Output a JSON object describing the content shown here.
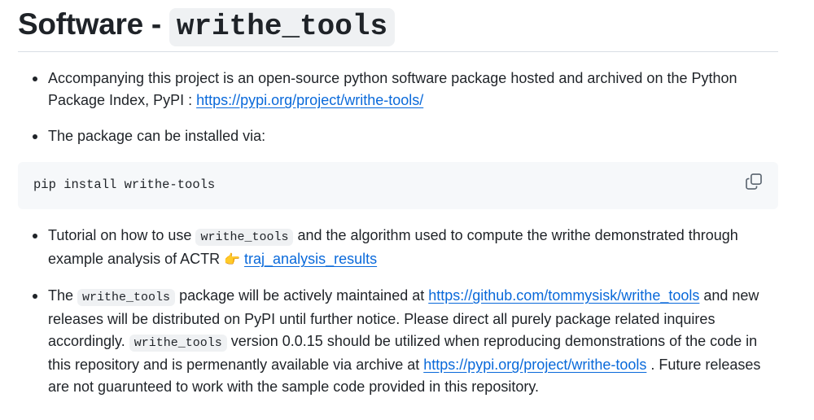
{
  "heading": {
    "prefix": "Software - ",
    "code": "writhe_tools"
  },
  "bullets": {
    "b1": {
      "text": "Accompanying this project is an open-source python software package hosted and archived on the Python Package Index, PyPI : ",
      "link": "https://pypi.org/project/writhe-tools/"
    },
    "b2": {
      "text": "The package can be installed via:"
    },
    "b3": {
      "t1": "Tutorial on how to use ",
      "code": "writhe_tools",
      "t2": " and the algorithm used to compute the writhe demonstrated through example analysis of ACTR ",
      "emoji": "👉",
      "link": "traj_analysis_results"
    },
    "b4": {
      "t1": "The ",
      "code1": "writhe_tools",
      "t2": " package will be actively maintained at ",
      "link1": "https://github.com/tommysisk/writhe_tools",
      "t3": " and new releases will be distributed on PyPI until further notice. Please direct all purely package related inquires accordingly. ",
      "code2": "writhe_tools",
      "t4": " version 0.0.15 should be utilized when reproducing demonstrations of the code in this repository and is permenantly available via archive at ",
      "link2": "https://pypi.org/project/writhe-tools",
      "t5": " . Future releases are not guarunteed to work with the sample code provided in this repository."
    }
  },
  "codeblock": {
    "command": "pip install writhe-tools",
    "copy_icon": "copy-icon"
  }
}
